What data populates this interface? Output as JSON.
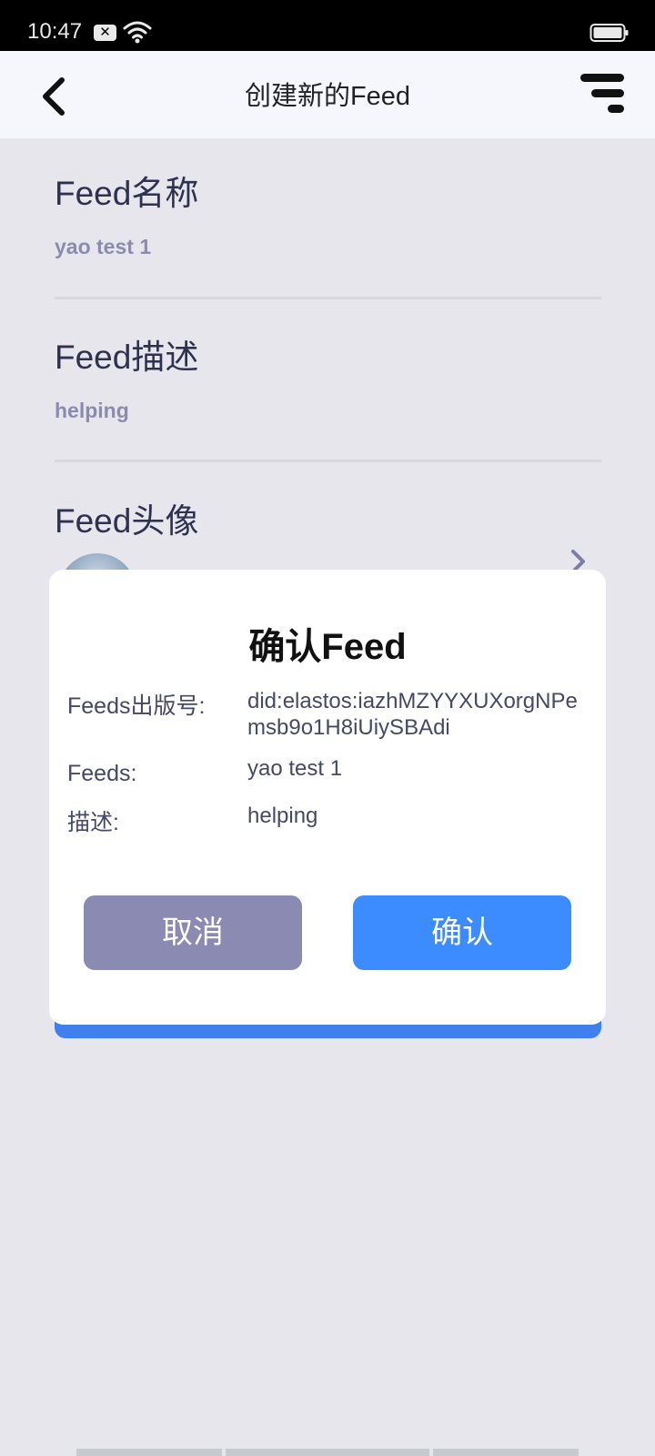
{
  "status_bar": {
    "time": "10:47",
    "icons": [
      "notification-x-icon",
      "wifi-icon",
      "battery-icon"
    ]
  },
  "header": {
    "title": "创建新的Feed",
    "back_icon": "back-arrow-icon",
    "menu_icon": "menu-icon"
  },
  "form": {
    "name_label": "Feed名称",
    "name_value": "yao test 1",
    "description_label": "Feed描述",
    "description_value": "helping",
    "avatar_label": "Feed头像"
  },
  "modal": {
    "title": "确认Feed",
    "did_label": "Feeds出版号:",
    "did_value": "did:elastos:iazhMZYYXUXorgNPemsb9o1H8iUiySBAdi",
    "feeds_label": "Feeds:",
    "feeds_value": "yao test 1",
    "desc_label": "描述:",
    "desc_value": "helping",
    "cancel_label": "取消",
    "confirm_label": "确认"
  },
  "colors": {
    "primary": "#3c8cff",
    "cancel": "#8a8ab2",
    "label": "#2f3150",
    "value_muted": "#8b8bb0"
  }
}
